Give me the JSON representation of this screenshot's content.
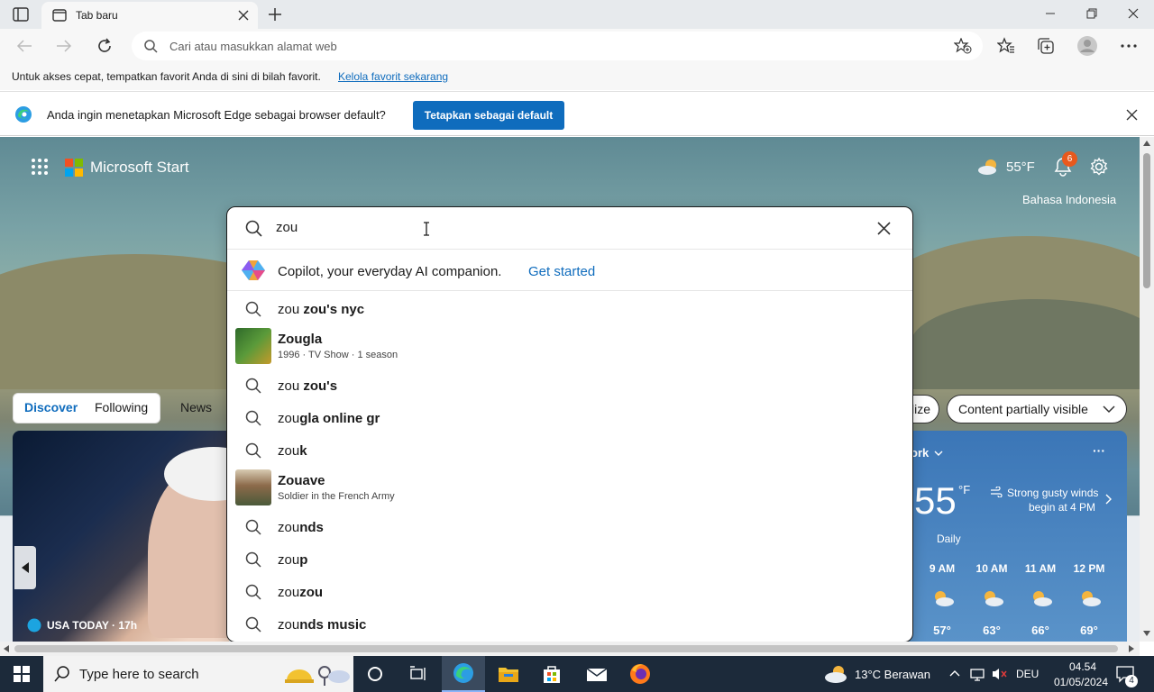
{
  "browser": {
    "tab_title": "Tab baru",
    "address_placeholder": "Cari atau masukkan alamat web",
    "favorites_message": "Untuk akses cepat, tempatkan favorit Anda di sini di bilah favorit.",
    "favorites_link": "Kelola favorit sekarang",
    "infobar_message": "Anda ingin menetapkan Microsoft Edge sebagai browser default?",
    "infobar_button": "Tetapkan sebagai default"
  },
  "start": {
    "brand": "Microsoft Start",
    "temperature": "55°F",
    "notification_count": "6",
    "language": "Bahasa Indonesia",
    "feed_tabs": [
      "Discover",
      "Following",
      "News"
    ],
    "pill_personalize": "lize",
    "pill_content": "Content partially visible",
    "hero_source": "USA TODAY · 17h",
    "weather": {
      "location": "ork",
      "temp": "55",
      "unit": "°F",
      "alert_line1": "Strong gusty winds",
      "alert_line2": "begin at 4 PM",
      "daily_tab": "Daily",
      "hours": [
        "9 AM",
        "10 AM",
        "11 AM",
        "12 PM"
      ],
      "temps": [
        "57°",
        "63°",
        "66°",
        "69°"
      ],
      "more": "···"
    }
  },
  "search": {
    "query": "zou",
    "copilot_text": "Copilot, your everyday AI companion.",
    "copilot_link": "Get started",
    "suggestions": [
      {
        "prefix": "zou ",
        "bold": "zou's nyc"
      },
      {
        "title": "Zougla",
        "subtitle": "1996 · TV Show · 1 season"
      },
      {
        "prefix": "zou ",
        "bold": "zou's"
      },
      {
        "prefix": "zou",
        "bold": "gla online gr"
      },
      {
        "prefix": "zou",
        "bold": "k"
      },
      {
        "title": "Zouave",
        "subtitle": "Soldier in the French Army"
      },
      {
        "prefix": "zou",
        "bold": "nds"
      },
      {
        "prefix": "zou",
        "bold": "p"
      },
      {
        "prefix": "zou",
        "bold": "zou"
      },
      {
        "prefix": "zou",
        "bold": "nds music"
      }
    ]
  },
  "taskbar": {
    "search_placeholder": "Type here to search",
    "weather": "13°C  Berawan",
    "language": "DEU",
    "time": "04.54",
    "date": "01/05/2024",
    "notification_count": "4"
  },
  "colors": {
    "accent": "#0f6cbd",
    "taskbar": "#1c2a3a",
    "badge": "#e8591d"
  }
}
